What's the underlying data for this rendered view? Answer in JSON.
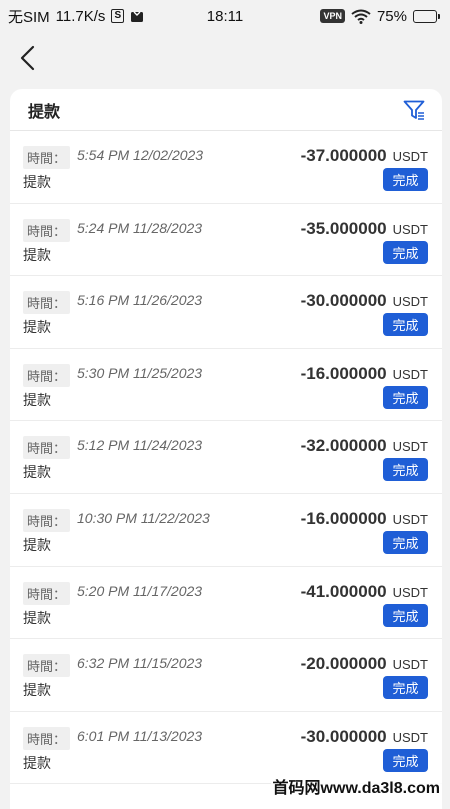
{
  "status_bar": {
    "carrier": "无SIM",
    "speed": "11.7K/s",
    "s_badge": "S",
    "time": "18:11",
    "vpn": "VPN",
    "battery": "75%",
    "battery_level": 0.75
  },
  "header": {
    "title": "提款",
    "filter_icon": "filter-icon",
    "back_icon": "back-chevron-icon"
  },
  "transactions": [
    {
      "time_label": "時間：",
      "time": "5:54 PM 12/02/2023",
      "type": "提款",
      "amount": "-37.000000",
      "currency": "USDT",
      "status": "完成"
    },
    {
      "time_label": "時間：",
      "time": "5:24 PM 11/28/2023",
      "type": "提款",
      "amount": "-35.000000",
      "currency": "USDT",
      "status": "完成"
    },
    {
      "time_label": "時間：",
      "time": "5:16 PM 11/26/2023",
      "type": "提款",
      "amount": "-30.000000",
      "currency": "USDT",
      "status": "完成"
    },
    {
      "time_label": "時間：",
      "time": "5:30 PM 11/25/2023",
      "type": "提款",
      "amount": "-16.000000",
      "currency": "USDT",
      "status": "完成"
    },
    {
      "time_label": "時間：",
      "time": "5:12 PM 11/24/2023",
      "type": "提款",
      "amount": "-32.000000",
      "currency": "USDT",
      "status": "完成"
    },
    {
      "time_label": "時間：",
      "time": "10:30 PM 11/22/2023",
      "type": "提款",
      "amount": "-16.000000",
      "currency": "USDT",
      "status": "完成"
    },
    {
      "time_label": "時間：",
      "time": "5:20 PM 11/17/2023",
      "type": "提款",
      "amount": "-41.000000",
      "currency": "USDT",
      "status": "完成"
    },
    {
      "time_label": "時間：",
      "time": "6:32 PM 11/15/2023",
      "type": "提款",
      "amount": "-20.000000",
      "currency": "USDT",
      "status": "完成"
    },
    {
      "time_label": "時間：",
      "time": "6:01 PM 11/13/2023",
      "type": "提款",
      "amount": "-30.000000",
      "currency": "USDT",
      "status": "完成"
    }
  ],
  "watermark": "首码网www.da3l8.com",
  "colors": {
    "accent": "#1f5ed6",
    "background": "#f2f2f2"
  }
}
